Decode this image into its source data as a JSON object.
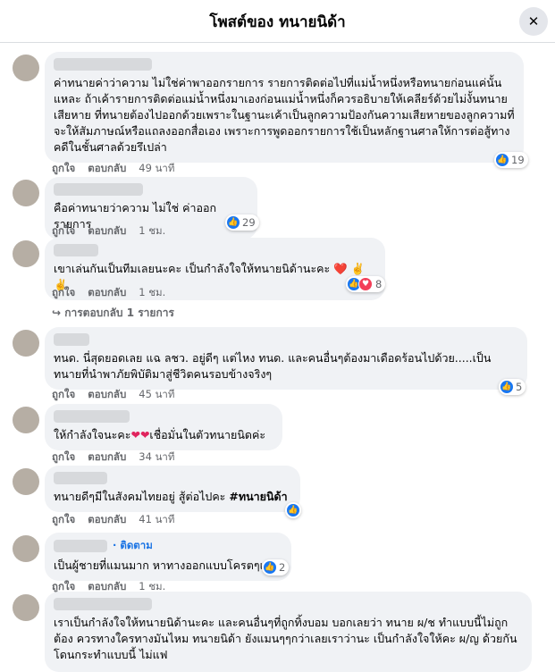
{
  "header": {
    "title": "โพสต์ของ ทนายนิด้า",
    "close_icon": "✕"
  },
  "actions": {
    "like": "ถูกใจ",
    "reply": "ตอบกลับ"
  },
  "comments": [
    {
      "text": "ค่าทนายค่าว่าความ ไม่ใช่ค่าพาออกรายการ รายการติดต่อไปที่แม่น้ำหนึ่งหรือทนายก่อนแค่นั้นแหละ ถ้าเค้ารายการติดต่อแม่น้ำหนึ่งมาเองก่อนแม่น้ำหนึ่งก็ควรอธิบายให้เคลียร์ด้วยไม่งั้นทนายเสียหาย ที่ทนายต้องไปออกด้วยเพราะในฐานะเค้าเป็นลูกความป้องกันความเสียหายของลูกความที่จะให้สัมภาษณ์หรือแถลงออกสื่อเอง เพราะการพูดออกรายการใช้เป็นหลักฐานศาลให้การต่อสู้ทางคดีในชั้นศาลด้วยรึเปล่า",
      "time": "49 นาที",
      "reactions": "19"
    },
    {
      "text": "คือค่าทนายว่าความ ไม่ใช่ ค่าออกรายการ",
      "time": "1 ชม.",
      "reactions": "29"
    },
    {
      "text": "เขาเล่นกันเป็นทีมเลยนะคะ เป็นกำลังใจให้ทนายนิด้านะคะ ❤️ ✌️✌️",
      "time": "1 ชม.",
      "reactions": "8",
      "replies": "↪ การตอบกลับ 1 รายการ"
    },
    {
      "text": "ทนด. นี่สุดยอดเลย แฉ ลชว. อยู่ดีๆ แต่ไหง ทนด. และคนอื่นๆต้องมาเดือดร้อนไปด้วย.....เป็นทนายที่นำพาภัยพิบัติมาสู่ชีวิตคนรอบข้างจริงๆ",
      "time": "45 นาที",
      "reactions": "5"
    },
    {
      "text_a": "ให้กำลังใจนะคะ",
      "text_hearts": "❤❤",
      "text_b": "เชื่อมั่นในตัวทนายนิดค่ะ",
      "time": "34 นาที"
    },
    {
      "text_a": "ทนายดีๆมีในสังคมไทยอยู่ สู้ต่อไปคะ ",
      "hashtag": "#ทนายนิด้า",
      "time": "41 นาที"
    },
    {
      "follow": "· ติดตาม",
      "text": "เป็นผู้ชายที่แมนมาก หาทางออกแบบโครตๆแมน",
      "time": "1 ชม.",
      "reactions": "2"
    },
    {
      "text": "เราเป็นกำลังใจให้ทนายนิด้านะคะ และคนอื่นๆที่ถูกทิ้งบอม บอกเลยว่า ทนาย ผ/ช ทำแบบนี้ไม่ถูกต้อง ควรทางใครทางมันไหม ทนายนิด้า ยังแมนๆๆกว่าเลยเราว่านะ เป็นกำลังใจให้คะ ผ/ญ ด้วยกันโดนกระทำแบบนี้ ไม่แฟ"
    }
  ]
}
